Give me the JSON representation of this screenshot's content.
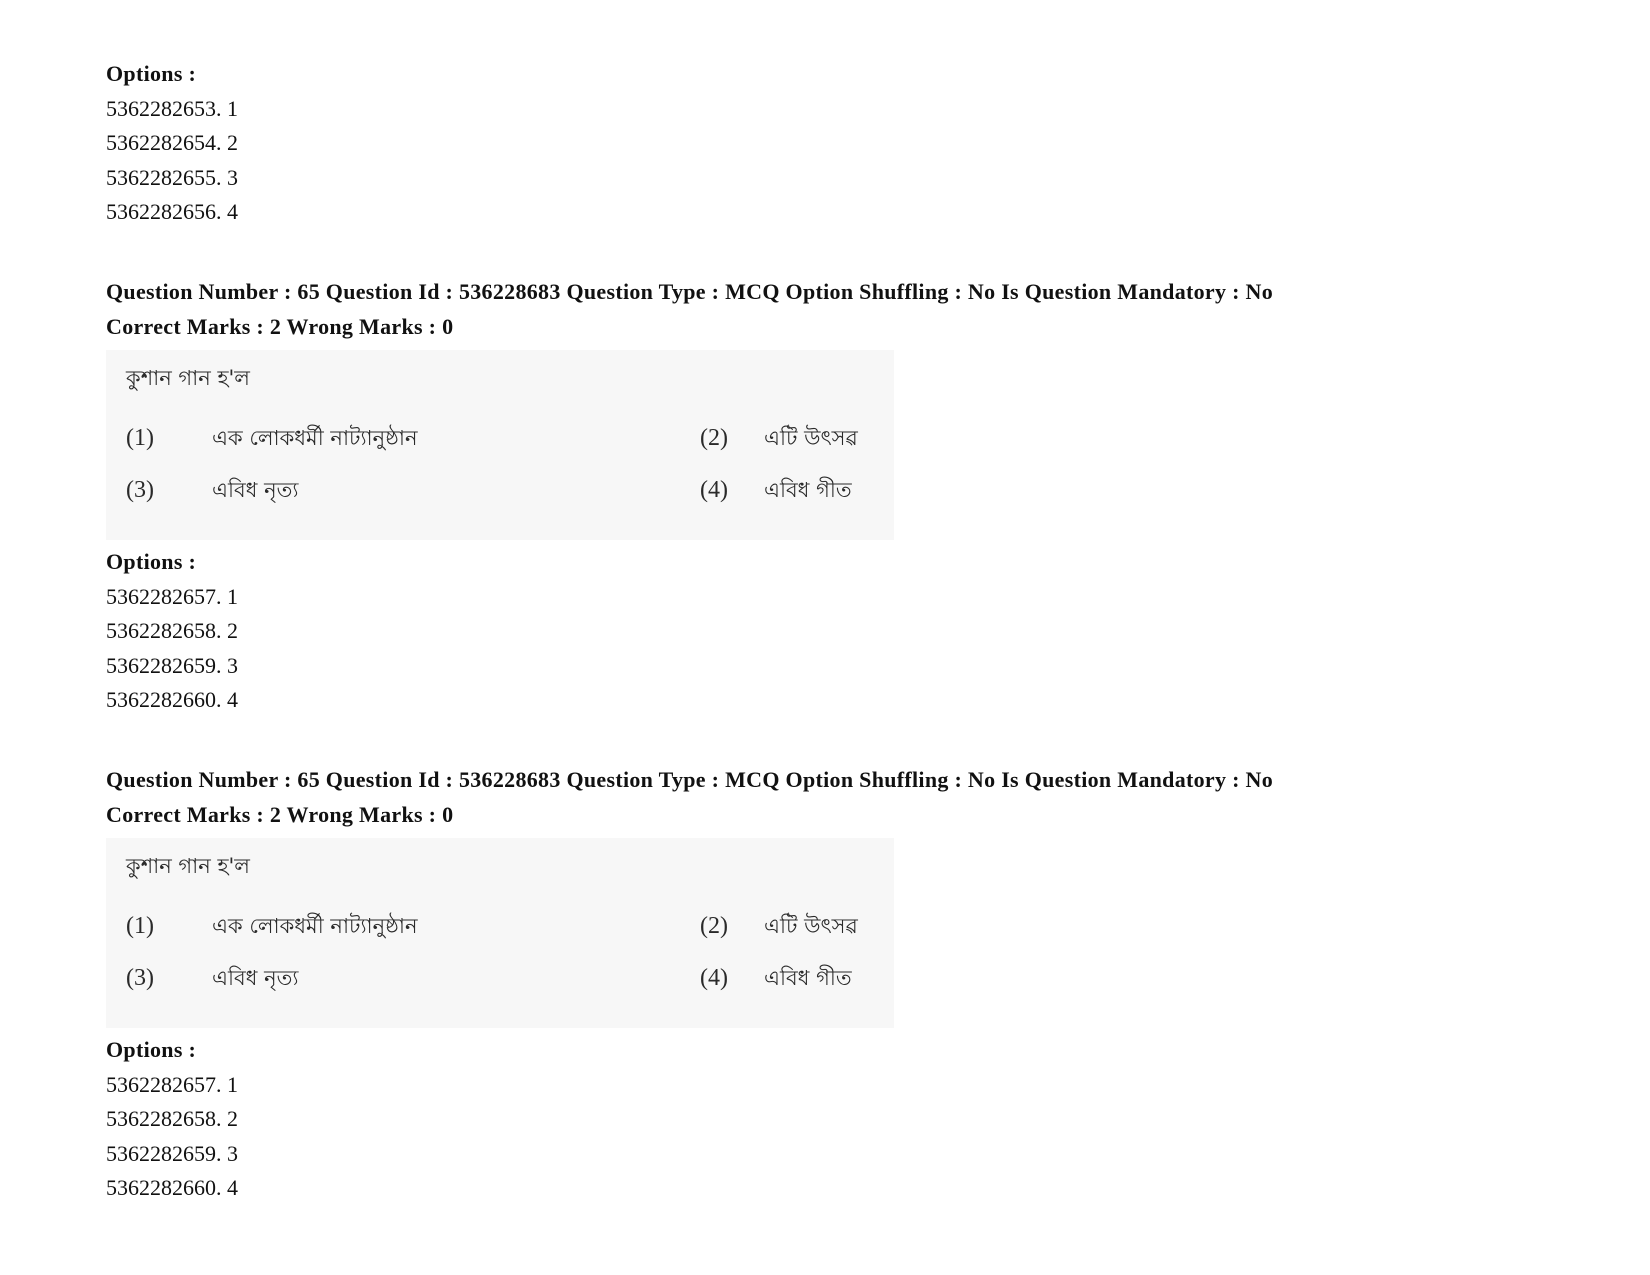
{
  "top_options": {
    "label": "Options :",
    "items": [
      "5362282653. 1",
      "5362282654. 2",
      "5362282655. 3",
      "5362282656. 4"
    ]
  },
  "questions": [
    {
      "header_line1": "Question Number : 65 Question Id : 536228683 Question Type : MCQ Option Shuffling : No Is Question Mandatory : No",
      "header_line2": "Correct Marks : 2 Wrong Marks : 0",
      "stem": "কুশান গান হ'ল",
      "choices": [
        {
          "num": "(1)",
          "text": "এক লোকধর্মী নাট্যানুষ্ঠান"
        },
        {
          "num": "(2)",
          "text": "এটি উৎসৱ"
        },
        {
          "num": "(3)",
          "text": "এবিধ নৃত্য"
        },
        {
          "num": "(4)",
          "text": "এবিধ গীত"
        }
      ],
      "options_label": "Options :",
      "options": [
        "5362282657. 1",
        "5362282658. 2",
        "5362282659. 3",
        "5362282660. 4"
      ]
    },
    {
      "header_line1": "Question Number : 65 Question Id : 536228683 Question Type : MCQ Option Shuffling : No Is Question Mandatory : No",
      "header_line2": "Correct Marks : 2 Wrong Marks : 0",
      "stem": "কুশান গান হ'ল",
      "choices": [
        {
          "num": "(1)",
          "text": "এক লোকধর্মী নাট্যানুষ্ঠান"
        },
        {
          "num": "(2)",
          "text": "এটি উৎসৱ"
        },
        {
          "num": "(3)",
          "text": "এবিধ নৃত্য"
        },
        {
          "num": "(4)",
          "text": "এবিধ গীত"
        }
      ],
      "options_label": "Options :",
      "options": [
        "5362282657. 1",
        "5362282658. 2",
        "5362282659. 3",
        "5362282660. 4"
      ]
    }
  ]
}
